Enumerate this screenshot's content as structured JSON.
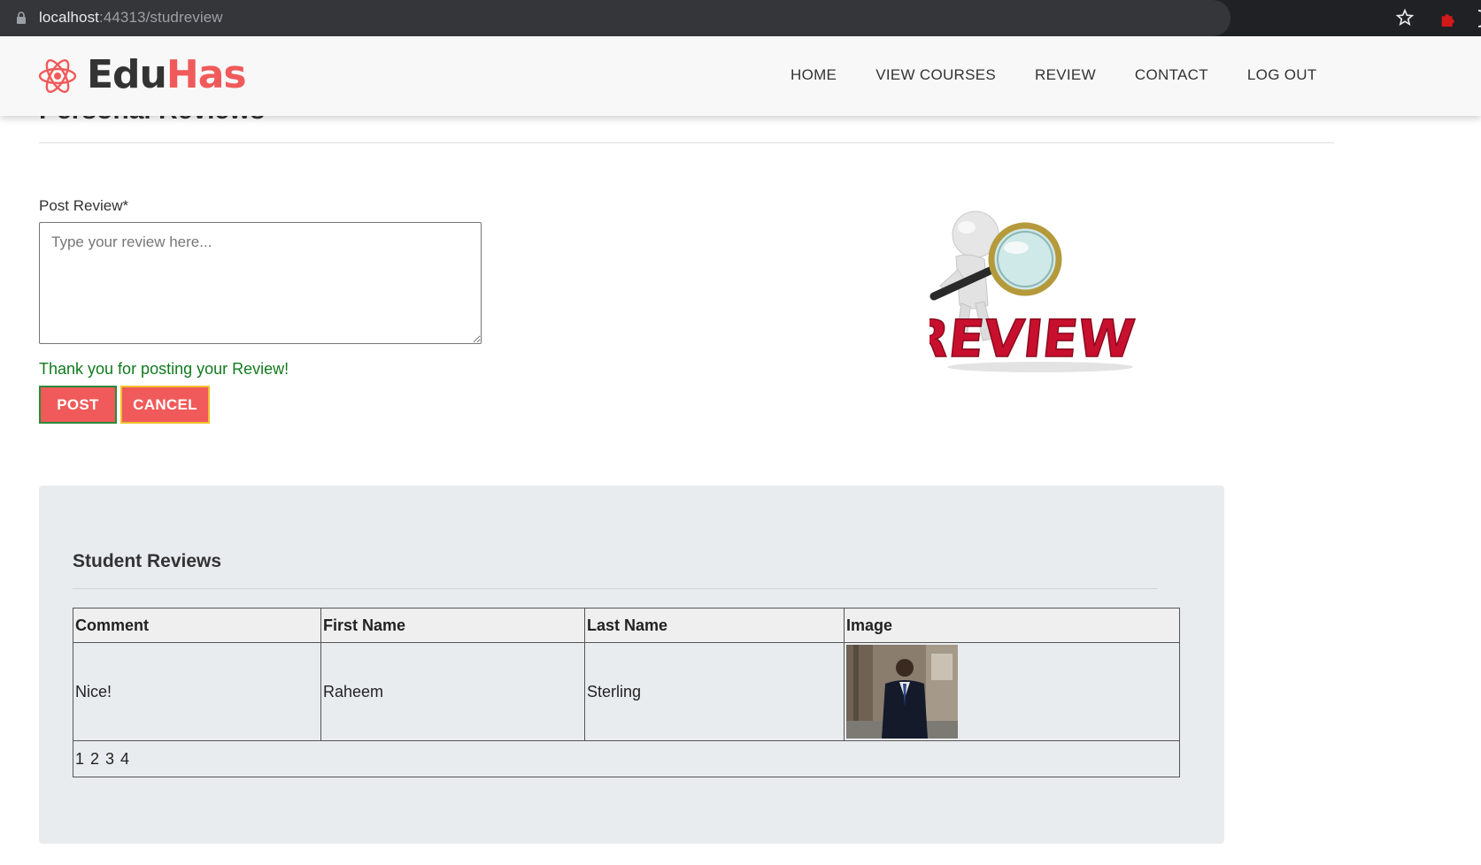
{
  "browser": {
    "url_host": "localhost",
    "url_rest": ":44313/studreview"
  },
  "nav": {
    "logo_part1": "Edu",
    "logo_part2": "Has",
    "links": [
      "HOME",
      "VIEW COURSES",
      "REVIEW",
      "CONTACT",
      "LOG OUT"
    ]
  },
  "page": {
    "title": "Personal Reviews"
  },
  "form": {
    "label": "Post Review*",
    "placeholder": "Type your review here...",
    "success_message": "Thank you for posting your Review!",
    "post_label": "POST",
    "cancel_label": "CANCEL"
  },
  "illustration": {
    "text": "REVIEW"
  },
  "reviews": {
    "title": "Student Reviews",
    "columns": [
      "Comment",
      "First Name",
      "Last Name",
      "Image"
    ],
    "rows": [
      {
        "comment": "Nice!",
        "first_name": "Raheem",
        "last_name": "Sterling"
      }
    ],
    "pager": "1 2 3 4"
  },
  "colors": {
    "accent": "#f15a5a",
    "success": "#117a1d",
    "panel_bg": "#e9ecef"
  }
}
